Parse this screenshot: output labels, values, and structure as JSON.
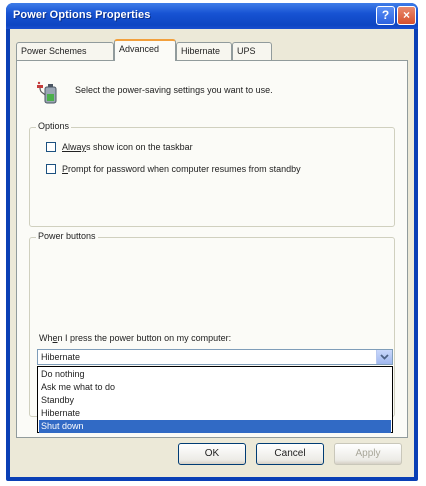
{
  "window": {
    "title": "Power Options Properties",
    "help_glyph": "?",
    "close_glyph": "×"
  },
  "tabs": [
    {
      "label": "Power Schemes"
    },
    {
      "label": "Advanced"
    },
    {
      "label": "Hibernate"
    },
    {
      "label": "UPS"
    }
  ],
  "header": {
    "text": "Select the power-saving settings you want to use.",
    "icon": "power-plug-battery-icon"
  },
  "options_group": {
    "label": "Options",
    "checkbox1_label_u": "Alway",
    "checkbox1_label_rest": "s show icon on the taskbar",
    "checkbox1_checked": false,
    "checkbox2_label_u": "P",
    "checkbox2_label_rest": "rompt for password when computer resumes from standby",
    "checkbox2_checked": false
  },
  "power_buttons_group": {
    "label": "Power buttons",
    "prompt_u": "e",
    "prompt_before": "Wh",
    "prompt_after": "n I press the power button on my computer:",
    "selected_value": "Hibernate",
    "options": [
      "Do nothing",
      "Ask me what to do",
      "Standby",
      "Hibernate",
      "Shut down"
    ],
    "highlighted_option": "Shut down"
  },
  "buttons": {
    "ok": "OK",
    "cancel": "Cancel",
    "apply": "Apply"
  },
  "colors": {
    "titlebar": "#1753d3",
    "selection": "#316ac5",
    "active_tab_accent": "#f2a03d"
  }
}
